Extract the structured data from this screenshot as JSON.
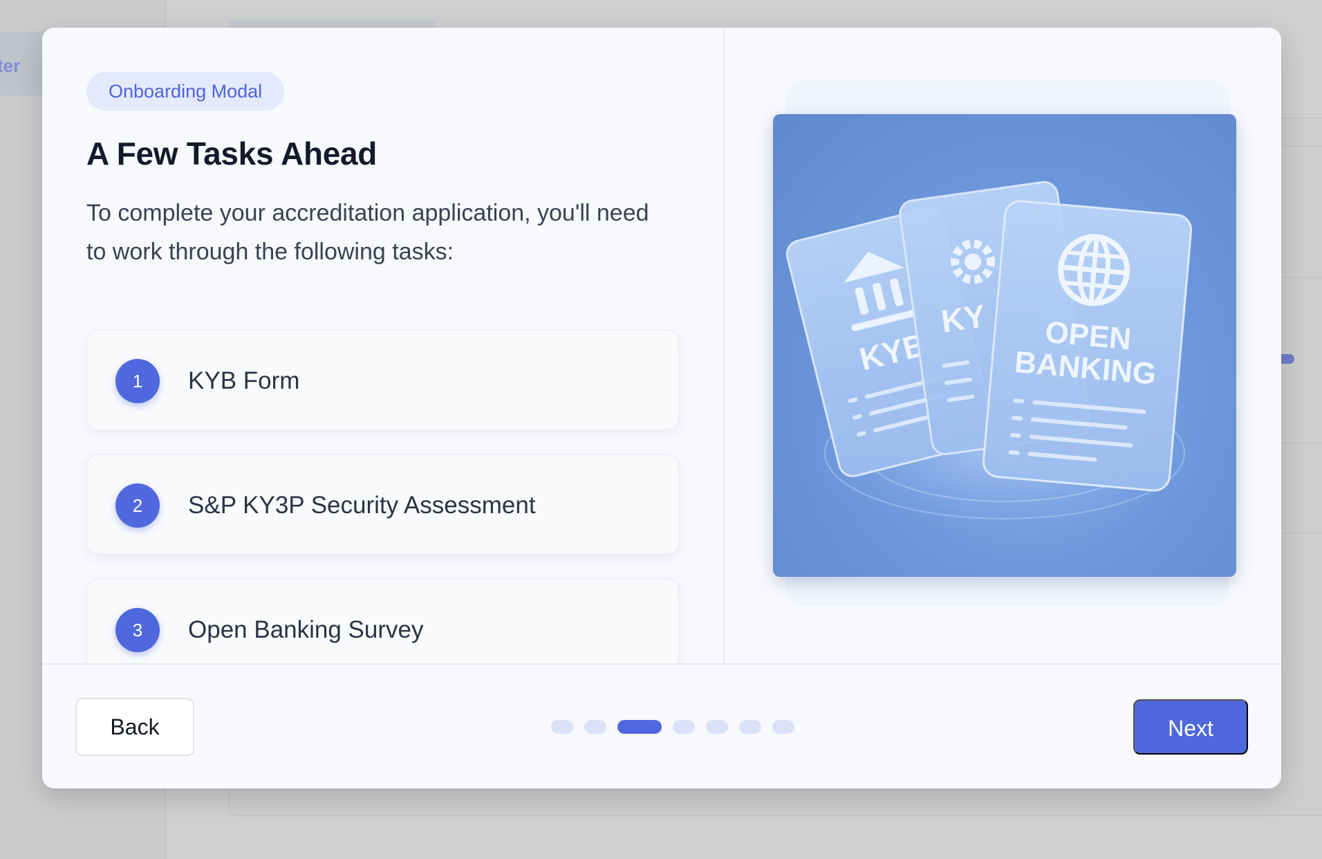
{
  "background": {
    "sidebar_item_fragment": "ter"
  },
  "modal": {
    "badge": "Onboarding Modal",
    "title": "A Few Tasks Ahead",
    "description": "To complete your accreditation application, you'll need to work through the following tasks:",
    "tasks": [
      {
        "number": "1",
        "label": "KYB Form"
      },
      {
        "number": "2",
        "label": "S&P KY3P Security Assessment"
      },
      {
        "number": "3",
        "label": "Open Banking Survey"
      }
    ],
    "illustration": {
      "card_left_text": "KYB",
      "card_middle_text": "KY",
      "card_right_line1": "OPEN",
      "card_right_line2": "BANKING",
      "icons": [
        "bank-icon",
        "gear-icon",
        "globe-icon"
      ]
    },
    "footer": {
      "back_label": "Back",
      "next_label": "Next",
      "steps_total": 7,
      "active_step": 3
    }
  },
  "colors": {
    "accent": "#4f68de",
    "badge_bg": "#e4e9fb",
    "title": "#141a2b",
    "body_text": "#3b4152"
  }
}
